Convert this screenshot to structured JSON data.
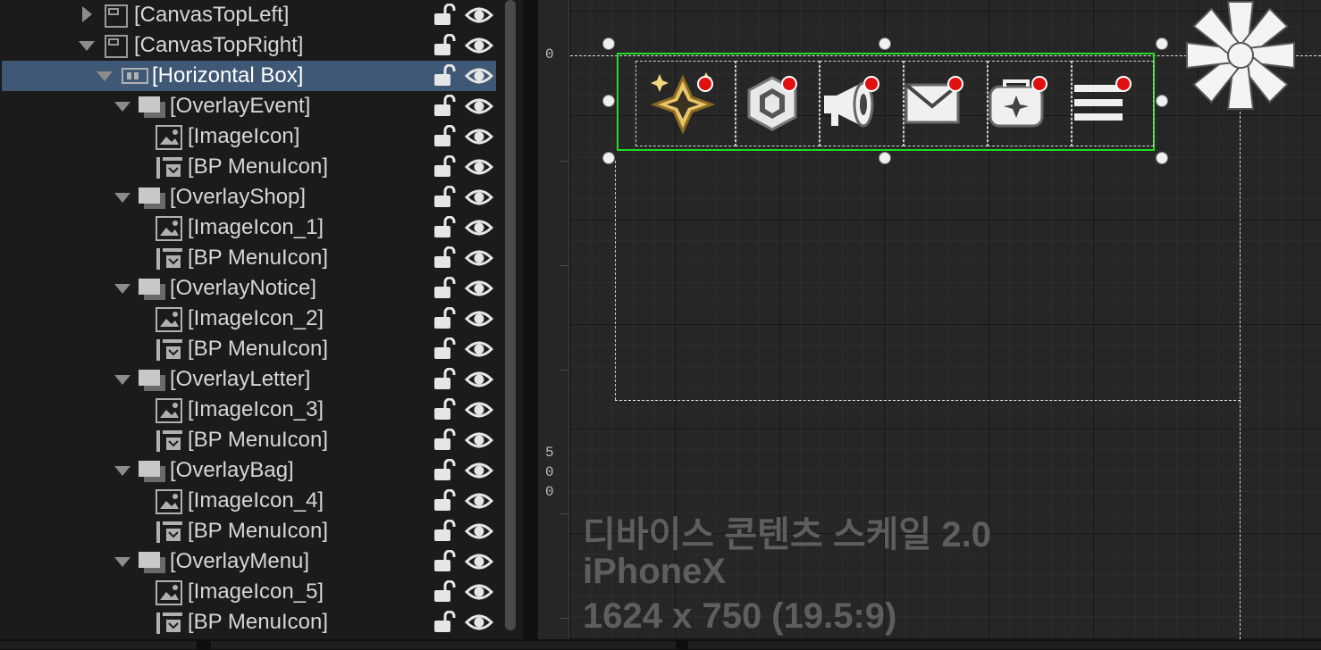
{
  "hierarchy": {
    "rows": [
      {
        "label": "[CanvasTopLeft]"
      },
      {
        "label": "[CanvasTopRight]"
      },
      {
        "label": "[Horizontal Box]"
      },
      {
        "label": "[OverlayEvent]"
      },
      {
        "label": "[ImageIcon]"
      },
      {
        "label": "[BP MenuIcon]"
      },
      {
        "label": "[OverlayShop]"
      },
      {
        "label": "[ImageIcon_1]"
      },
      {
        "label": "[BP MenuIcon]"
      },
      {
        "label": "[OverlayNotice]"
      },
      {
        "label": "[ImageIcon_2]"
      },
      {
        "label": "[BP MenuIcon]"
      },
      {
        "label": "[OverlayLetter]"
      },
      {
        "label": "[ImageIcon_3]"
      },
      {
        "label": "[BP MenuIcon]"
      },
      {
        "label": "[OverlayBag]"
      },
      {
        "label": "[ImageIcon_4]"
      },
      {
        "label": "[BP MenuIcon]"
      },
      {
        "label": "[OverlayMenu]"
      },
      {
        "label": "[ImageIcon_5]"
      },
      {
        "label": "[BP MenuIcon]"
      }
    ]
  },
  "ruler": {
    "top_label": "0",
    "mid_label_1": "5",
    "mid_label_2": "0",
    "mid_label_3": "0"
  },
  "canvas_info": {
    "scale": "디바이스 콘텐츠 스케일 2.0",
    "device": "iPhoneX",
    "resolution": "1624 x 750 (19.5:9)"
  },
  "colors": {
    "selection": "#3f5875",
    "widget_outline": "#22dd22",
    "badge": "#e01010"
  }
}
